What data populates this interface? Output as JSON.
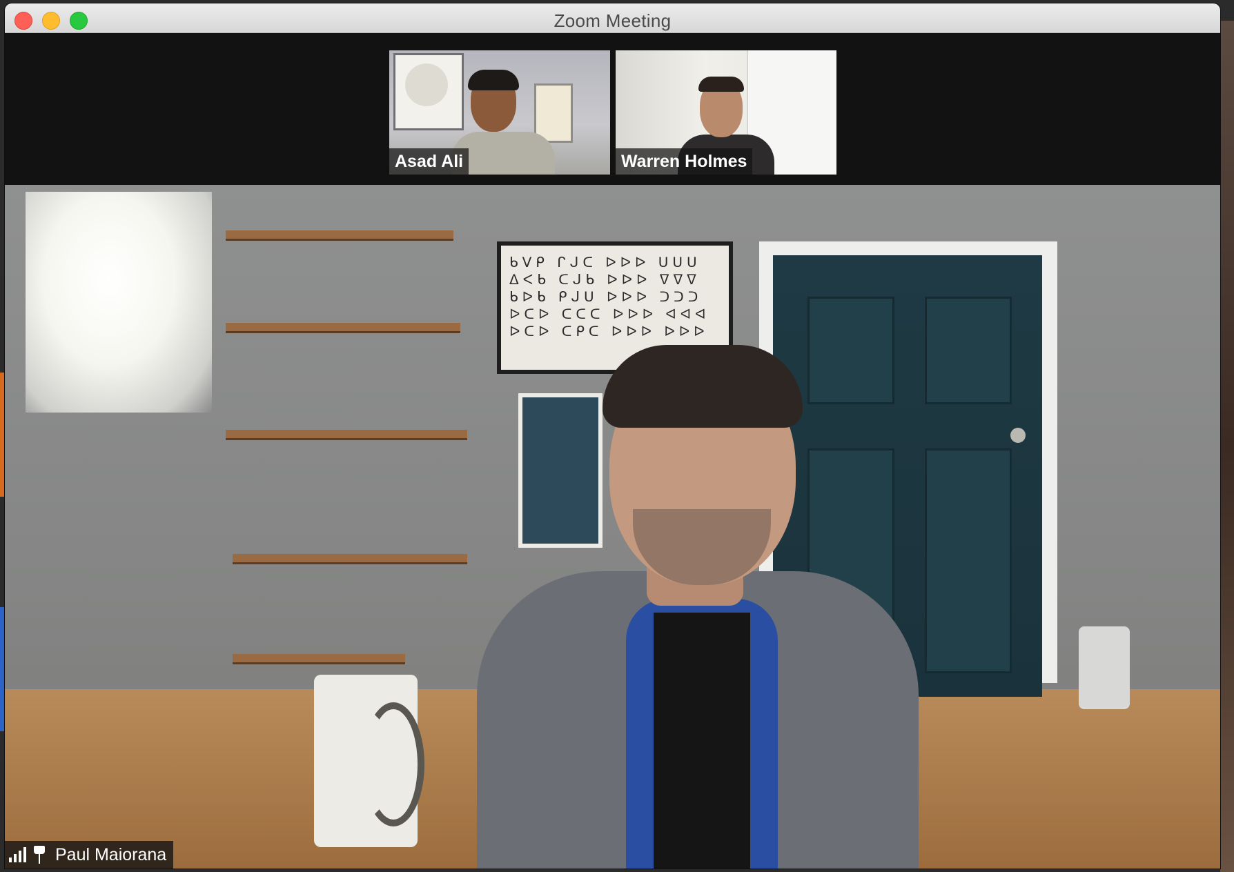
{
  "window": {
    "title": "Zoom Meeting"
  },
  "gallery": {
    "participants": [
      {
        "name": "Asad Ali"
      },
      {
        "name": "Warren Holmes"
      }
    ]
  },
  "active_speaker": {
    "name": "Paul Maiorana",
    "pinned": true,
    "signal_icon": "signal-strength-icon",
    "pin_icon": "pin-icon"
  },
  "colors": {
    "close": "#fe5f57",
    "minimize": "#febc2e",
    "maximize": "#28c840",
    "strip_background": "#121212"
  }
}
